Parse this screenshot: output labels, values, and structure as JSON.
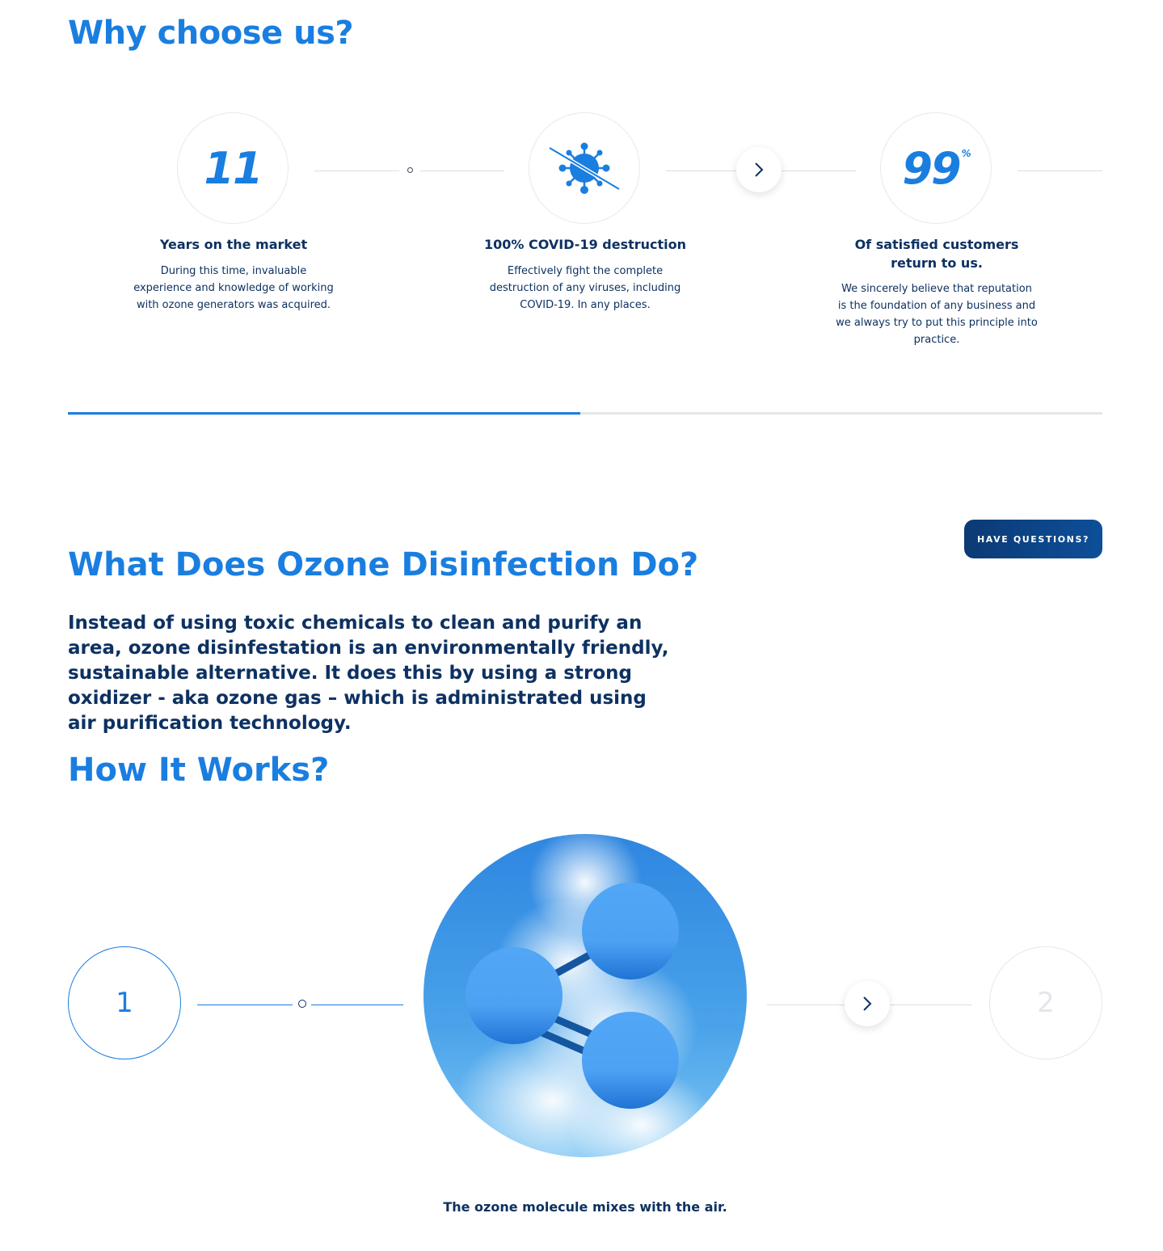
{
  "why": {
    "title": "Why choose us?",
    "stats": [
      {
        "value": "11",
        "title": "Years on the market",
        "text": "During this time, invaluable experience and knowledge of working with ozone generators was acquired."
      },
      {
        "icon": "virus-crossed-icon",
        "title": "100% COVID-19 destruction",
        "text": "Effectively fight the complete destruction of any viruses, including COVID-19. In any places."
      },
      {
        "value": "99",
        "suffix": "%",
        "title": "Of satisfied customers return to us.",
        "text": "We sincerely believe that reputation is the foundation of any business and we always try to put this principle into practice."
      }
    ],
    "progress": 0.495
  },
  "cta": {
    "have_questions": "Have questions?"
  },
  "ozone": {
    "title": "What Does Ozone Disinfection Do?",
    "description": "Instead of using toxic chemicals to clean and purify an area, ozone disinfestation is an environmentally friendly, sustainable alternative. It does this by using a strong oxidizer - aka ozone gas – which is administrated using air purification technology."
  },
  "how": {
    "title": "How It Works?",
    "steps": [
      {
        "number": "1",
        "caption": "The ozone molecule mixes with the air."
      },
      {
        "number": "2"
      }
    ]
  },
  "colors": {
    "accent": "#1a7ee0",
    "navy": "#0d3161",
    "button": "#0c3a74"
  }
}
